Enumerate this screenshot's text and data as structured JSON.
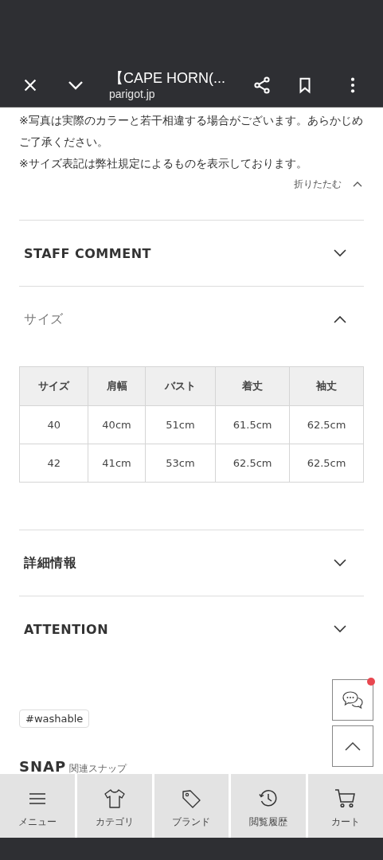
{
  "toolbar": {
    "title": "【CAPE HORN(...",
    "domain": "parigot.jp"
  },
  "notes": {
    "lines": [
      "※写真は実際のカラーと若干相違する場合がございます。あらかじめご了承ください。",
      "※サイズ表記は弊社規定によるものを表示しております。"
    ],
    "collapse_label": "折りたたむ"
  },
  "sections": [
    {
      "title": "STAFF COMMENT",
      "expanded": false
    },
    {
      "title": "サイズ",
      "expanded": true,
      "table": {
        "columns": [
          "サイズ",
          "肩幅",
          "バスト",
          "着丈",
          "袖丈"
        ],
        "rows": [
          [
            "40",
            "40cm",
            "51cm",
            "61.5cm",
            "62.5cm"
          ],
          [
            "42",
            "41cm",
            "53cm",
            "62.5cm",
            "62.5cm"
          ]
        ]
      }
    },
    {
      "title": "詳細情報",
      "expanded": false
    },
    {
      "title": "ATTENTION",
      "expanded": false
    }
  ],
  "tags": [
    "#washable"
  ],
  "snap": {
    "title": "SNAP",
    "subtitle": "関連スナップ"
  },
  "floating": {
    "chat_notification": true
  },
  "bottom_nav": [
    {
      "kind": "menu",
      "label": "メニュー"
    },
    {
      "kind": "category",
      "label": "カテゴリ"
    },
    {
      "kind": "brand",
      "label": "ブランド"
    },
    {
      "kind": "history",
      "label": "閲覧履歴"
    },
    {
      "kind": "cart",
      "label": "カート"
    }
  ]
}
